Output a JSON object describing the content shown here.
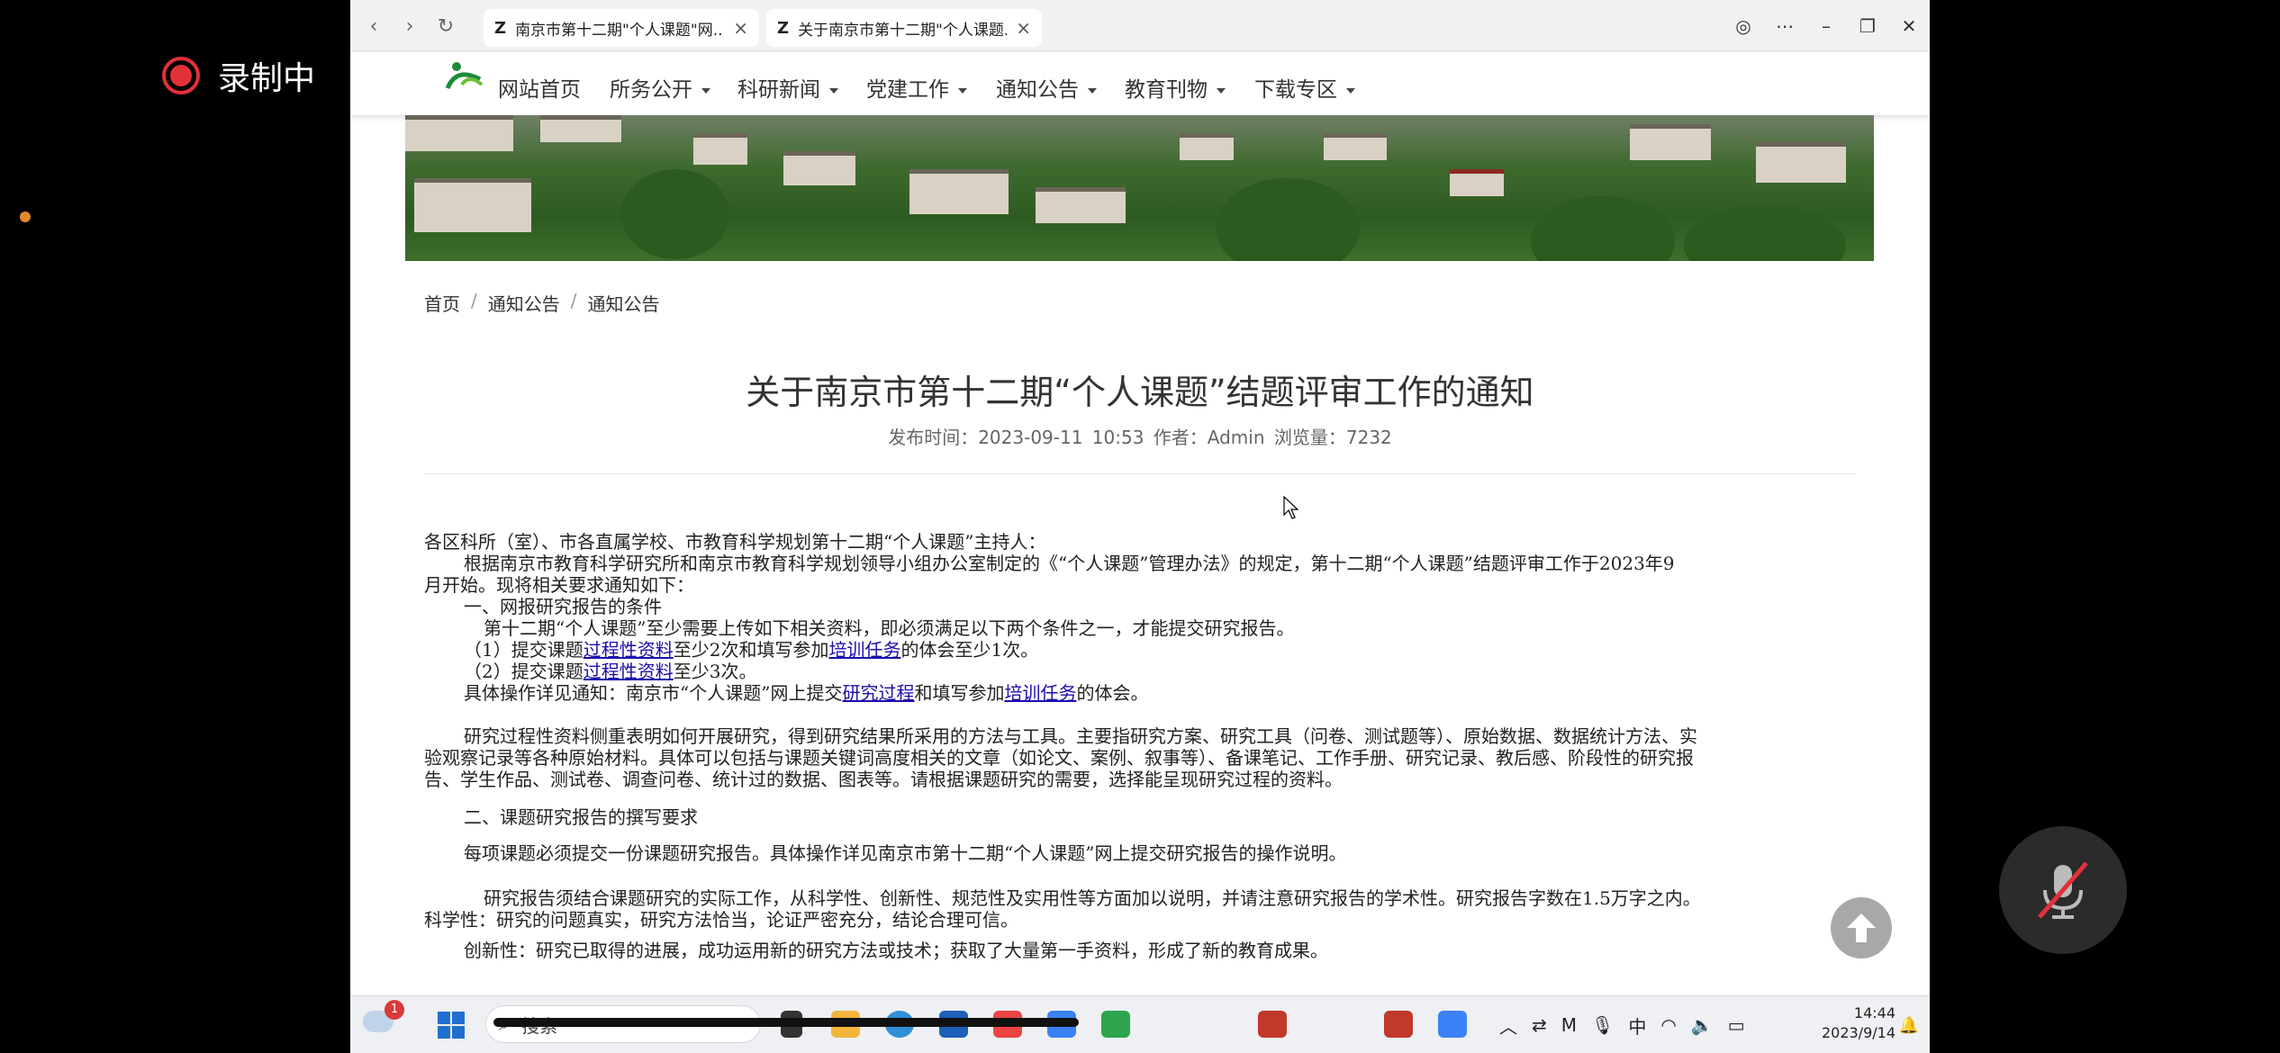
{
  "recording": {
    "label": "录制中"
  },
  "browser": {
    "tabs": [
      {
        "title": "南京市第十二期\"个人课题\"网..."
      },
      {
        "title": "关于南京市第十二期\"个人课题..."
      }
    ]
  },
  "site": {
    "nav": [
      "网站首页",
      "所务公开",
      "科研新闻",
      "党建工作",
      "通知公告",
      "教育刊物",
      "下载专区"
    ]
  },
  "breadcrumb": [
    "首页",
    "通知公告",
    "通知公告"
  ],
  "article": {
    "title": "关于南京市第十二期“个人课题”结题评审工作的通知",
    "meta": "发布时间：2023-09-11 10:53   作者：Admin   浏览量：7232",
    "p1": "各区科所（室）、市各直属学校、市教育科学规划第十二期“个人课题”主持人：",
    "p2": "根据南京市教育科学研究所和南京市教育科学规划领导小组办公室制定的《“个人课题”管理办法》的规定，第十二期“个人课题”结题评审工作于2023年9",
    "p2b": "月开始。现将相关要求通知如下：",
    "h1": "一、网报研究报告的条件",
    "p3": "第十二期“个人课题”至少需要上传如下相关资料，即必须满足以下两个条件之一，才能提交研究报告。",
    "c1a": "（1）提交课题",
    "c1link1": "过程性资料",
    "c1b": "至少2次和填写参加",
    "c1link2": "培训任务",
    "c1c": "的体会至少1次。",
    "c2a": "（2）提交课题",
    "c2link": "过程性资料",
    "c2b": "至少3次。",
    "opa": "具体操作详见通知：南京市“个人课题”网上提交",
    "oplink1": "研究过程",
    "opb": "和填写参加",
    "oplink2": "培训任务",
    "opc": "的体会。",
    "p4": "研究过程性资料侧重表明如何开展研究，得到研究结果所采用的方法与工具。主要指研究方案、研究工具（问卷、测试题等）、原始数据、数据统计方法、实",
    "p4b": "验观察记录等各种原始材料。具体可以包括与课题关键词高度相关的文章（如论文、案例、叙事等）、备课笔记、工作手册、研究记录、教后感、阶段性的研究报",
    "p4c": "告、学生作品、测试卷、调查问卷、统计过的数据、图表等。请根据课题研究的需要，选择能呈现研究过程的资料。",
    "h2": "二、课题研究报告的撰写要求",
    "p5": "每项课题必须提交一份课题研究报告。具体操作详见南京市第十二期“个人课题”网上提交研究报告的操作说明。",
    "p6": "研究报告须结合课题研究的实际工作，从科学性、创新性、规范性及实用性等方面加以说明，并请注意研究报告的学术性。研究报告字数在1.5万字之内。",
    "p6b": "科学性：研究的问题真实，研究方法恰当，论证严密充分，结论合理可信。",
    "p7": "创新性：研究已取得的进展，成功运用新的研究方法或技术；获取了大量第一手资料，形成了新的教育成果。"
  },
  "taskbar": {
    "search_label": "搜索",
    "weather_badge": "1",
    "ime": "中",
    "time": "14:44",
    "date": "2023/9/14"
  },
  "colors": {
    "link": "#1a0dab",
    "record": "#e2313a",
    "banner_green": "#2e5b22"
  }
}
